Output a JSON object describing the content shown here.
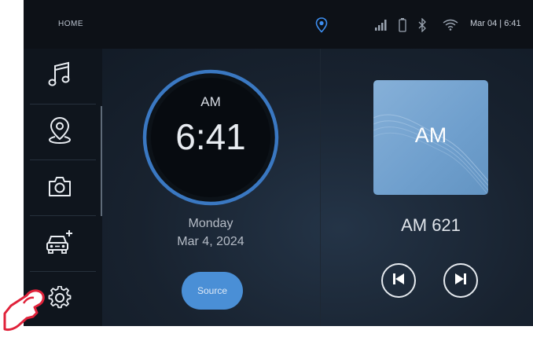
{
  "header": {
    "home_label": "HOME",
    "datetime": "Mar 04 | 6:41",
    "status_icons": [
      "location-pin-icon",
      "signal-bars-icon",
      "battery-icon",
      "bluetooth-icon",
      "wifi-icon"
    ]
  },
  "sidebar": {
    "items": [
      {
        "name": "music",
        "icon": "music-note-icon"
      },
      {
        "name": "navigation",
        "icon": "map-pin-icon"
      },
      {
        "name": "camera",
        "icon": "camera-icon"
      },
      {
        "name": "vehicle",
        "icon": "car-plus-icon"
      },
      {
        "name": "settings",
        "icon": "gear-icon"
      }
    ]
  },
  "clock": {
    "ampm": "AM",
    "time": "6:41",
    "day": "Monday",
    "date": "Mar 4, 2024",
    "source_label": "Source"
  },
  "radio": {
    "album_label": "AM",
    "station": "AM  621"
  },
  "colors": {
    "accent": "#4a8fd6",
    "album": "#78a6d3",
    "topbar": "#0d1117",
    "hand_outline": "#e0223a"
  }
}
